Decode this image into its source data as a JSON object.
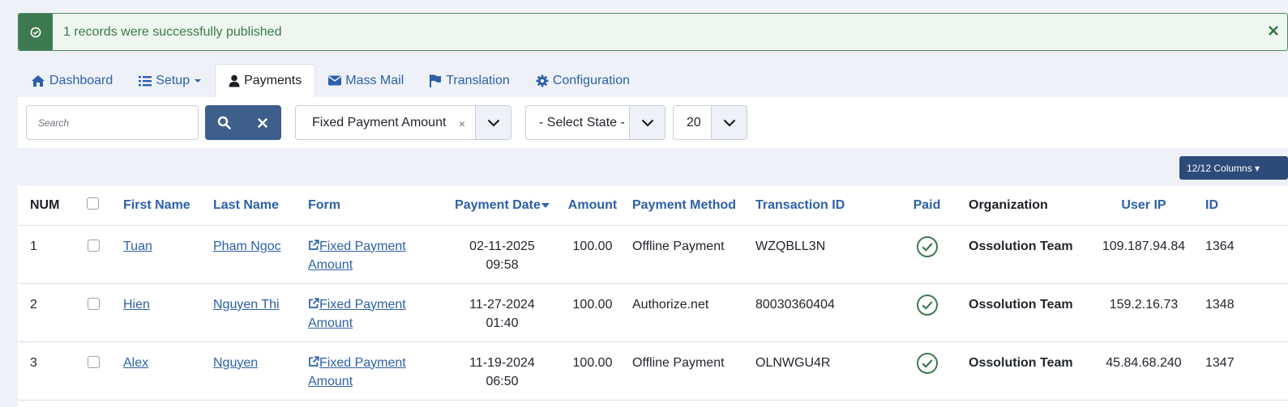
{
  "alert": {
    "message": "1 records were successfully published",
    "close": "×"
  },
  "tabs": [
    {
      "label": "Dashboard",
      "icon": "home-icon"
    },
    {
      "label": "Setup",
      "icon": "list-icon"
    },
    {
      "label": "Payments",
      "icon": "user-icon",
      "active": true
    },
    {
      "label": "Mass Mail",
      "icon": "envelope-icon"
    },
    {
      "label": "Translation",
      "icon": "flag-icon"
    },
    {
      "label": "Configuration",
      "icon": "gear-icon"
    }
  ],
  "filters": {
    "search_placeholder": "Search",
    "form_select": "Fixed Payment Amount",
    "form_clear": "×",
    "state_select": "- Select State -",
    "limit_select": "20"
  },
  "columns_button": "12/12 Columns ▾",
  "table": {
    "headers": {
      "num": "NUM",
      "first_name": "First Name",
      "last_name": "Last Name",
      "form": "Form",
      "payment_date": "Payment Date",
      "amount": "Amount",
      "payment_method": "Payment Method",
      "transaction_id": "Transaction ID",
      "paid": "Paid",
      "organization": "Organization",
      "user_ip": "User IP",
      "id": "ID"
    },
    "rows": [
      {
        "num": "1",
        "first_name": "Tuan",
        "last_name": "Pham Ngoc",
        "form_line1": "Fixed Payment",
        "form_line2": "Amount",
        "date": "02-11-2025",
        "time": "09:58",
        "amount": "100.00",
        "method": "Offline Payment",
        "transaction": "WZQBLL3N",
        "organization": "Ossolution Team",
        "ip": "109.187.94.84",
        "id": "1364"
      },
      {
        "num": "2",
        "first_name": "Hien",
        "last_name": "Nguyen Thi",
        "form_line1": "Fixed Payment",
        "form_line2": "Amount",
        "date": "11-27-2024",
        "time": "01:40",
        "amount": "100.00",
        "method": "Authorize.net",
        "transaction": "80030360404",
        "organization": "Ossolution Team",
        "ip": "159.2.16.73",
        "id": "1348"
      },
      {
        "num": "3",
        "first_name": "Alex",
        "last_name": "Nguyen",
        "form_line1": "Fixed Payment",
        "form_line2": "Amount",
        "date": "11-19-2024",
        "time": "06:50",
        "amount": "100.00",
        "method": "Offline Payment",
        "transaction": "OLNWGU4R",
        "organization": "Ossolution Team",
        "ip": "45.84.68.240",
        "id": "1347"
      }
    ]
  },
  "colors": {
    "accent": "#2d60a8",
    "success": "#3d7a4f",
    "button": "#3e5f8c"
  }
}
